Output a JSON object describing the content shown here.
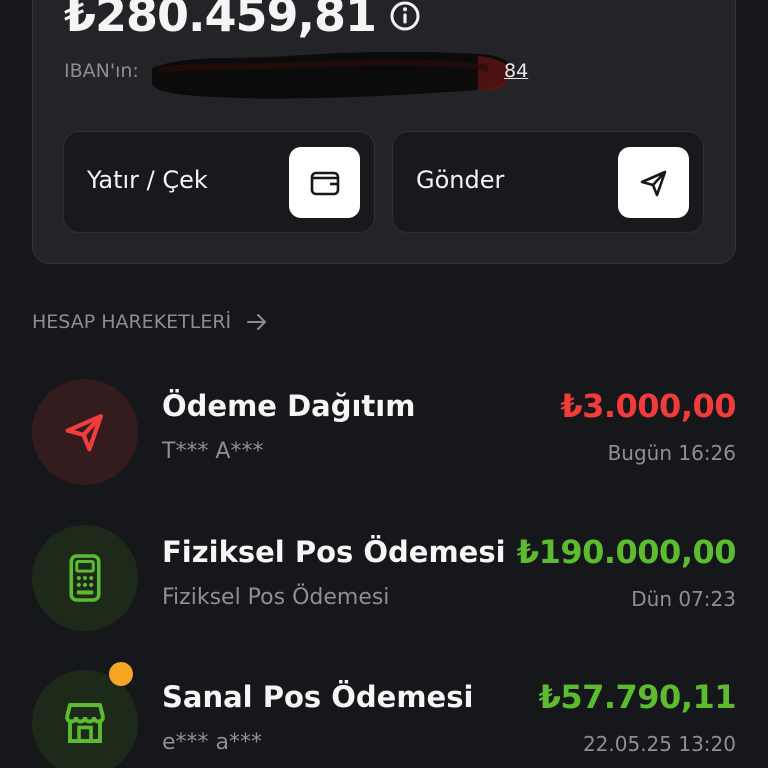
{
  "balance": {
    "amount": "₺280.459,81",
    "iban_label": "IBAN'ın:",
    "iban_tail": "84"
  },
  "actions": {
    "deposit_label": "Yatır / Çek",
    "send_label": "Gönder"
  },
  "section": {
    "title": "HESAP HAREKETLERİ"
  },
  "transactions": [
    {
      "title": "Ödeme Dağıtım",
      "subtitle": "T*** A***",
      "amount": "₺3.000,00",
      "time": "Bugün 16:26",
      "icon": "send-icon",
      "amount_color": "#f23b3b"
    },
    {
      "title": "Fiziksel Pos Ödemesi",
      "subtitle": "Fiziksel Pos Ödemesi",
      "amount": "₺190.000,00",
      "time": "Dün 07:23",
      "icon": "pos-terminal-icon",
      "amount_color": "#5dbb2f"
    },
    {
      "title": "Sanal Pos Ödemesi",
      "subtitle": "e*** a***",
      "amount": "₺57.790,11",
      "time": "22.05.25 13:20",
      "icon": "store-icon",
      "amount_color": "#5dbb2f"
    }
  ],
  "colors": {
    "background": "#16171b",
    "card": "#232428",
    "negative": "#f23b3b",
    "positive": "#5dbb2f",
    "notification_dot": "#f5a623"
  }
}
